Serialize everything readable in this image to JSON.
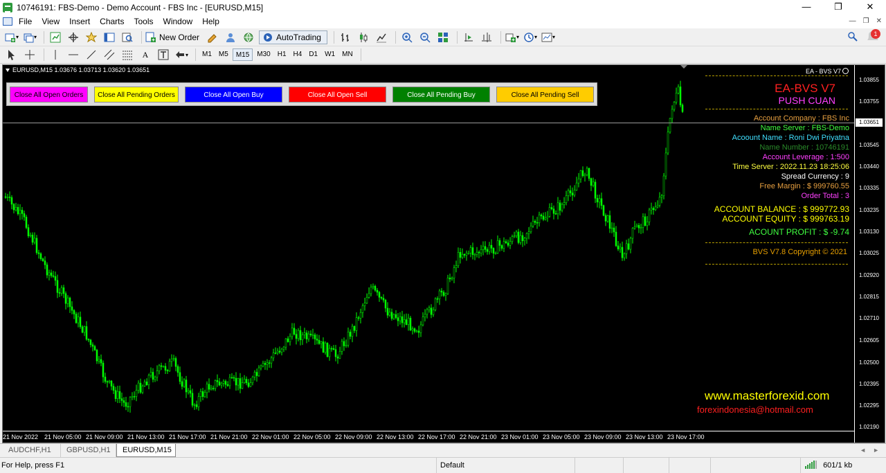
{
  "window": {
    "title": "10746191: FBS-Demo - Demo Account - FBS Inc - [EURUSD,M15]",
    "minimize": "—",
    "restore": "❐",
    "close": "✕"
  },
  "menu": [
    "File",
    "View",
    "Insert",
    "Charts",
    "Tools",
    "Window",
    "Help"
  ],
  "toolbar": {
    "new_order": "New Order",
    "autotrading": "AutoTrading"
  },
  "timeframes": [
    "M1",
    "M5",
    "M15",
    "M30",
    "H1",
    "H4",
    "D1",
    "W1",
    "MN"
  ],
  "active_timeframe": "M15",
  "chart": {
    "header": "EURUSD,M15  1.03676 1.03713 1.03620 1.03651",
    "ea_label": "EA - BVS V7",
    "current_price": "1.03651",
    "candle_color": "#00ff00"
  },
  "buttons": [
    {
      "label": "Close All Open Orders",
      "bg": "#ff00ff",
      "fg": "#000000"
    },
    {
      "label": "Close All Pending Orders",
      "bg": "#ffff00",
      "fg": "#000000"
    },
    {
      "label": "Close All Open Buy",
      "bg": "#0000ff",
      "fg": "#ffffff"
    },
    {
      "label": "Close All Open Sell",
      "bg": "#ff0000",
      "fg": "#ffffff"
    },
    {
      "label": "Close All Pending Buy",
      "bg": "#008000",
      "fg": "#ffffff"
    },
    {
      "label": "Close All Pending Sell",
      "bg": "#ffcc00",
      "fg": "#000000"
    }
  ],
  "info_panel": {
    "title": "EA-BVS V7",
    "subtitle": "PUSH CUAN",
    "account_company": "Account Company  : FBS Inc",
    "name_server": "Name Server  : FBS-Demo",
    "account_name": "Acoount Name  : Roni Dwi Priyatna",
    "name_number": "Name Number  : 10746191",
    "account_leverage": "Account Leverage  : 1:500",
    "time_server": "Time Server  : 2022.11.23 18:25:06",
    "spread_currency": "Spread Currency  : 9",
    "free_margin": "Free Margin  : $ 999760.55",
    "order_total": "Order Total  : 3",
    "account_balance": "ACCOUNT BALANCE  : $ 999772.93",
    "account_equity": "ACCOUNT EQUITY  : $ 999763.19",
    "account_profit": "ACOUNT PROFIT  : $ -9.74",
    "copyright": "BVS V7.8 Copyright © 2021"
  },
  "watermark": {
    "site": "www.masterforexid.com",
    "email": "forexindonesia@hotmail.com"
  },
  "price_axis": [
    "1.03855",
    "1.03755",
    "1.03545",
    "1.03440",
    "1.03335",
    "1.03235",
    "1.03130",
    "1.03025",
    "1.02920",
    "1.02815",
    "1.02710",
    "1.02605",
    "1.02500",
    "1.02395",
    "1.02295",
    "1.02190"
  ],
  "time_axis": [
    "21 Nov 2022",
    "21 Nov 05:00",
    "21 Nov 09:00",
    "21 Nov 13:00",
    "21 Nov 17:00",
    "21 Nov 21:00",
    "22 Nov 01:00",
    "22 Nov 05:00",
    "22 Nov 09:00",
    "22 Nov 13:00",
    "22 Nov 17:00",
    "22 Nov 21:00",
    "23 Nov 01:00",
    "23 Nov 05:00",
    "23 Nov 09:00",
    "23 Nov 13:00",
    "23 Nov 17:00"
  ],
  "tabs": [
    "AUDCHF,H1",
    "GBPUSD,H1",
    "EURUSD,M15"
  ],
  "active_tab": "EURUSD,M15",
  "status": {
    "help": "For Help, press F1",
    "profile": "Default",
    "traffic": "601/1 kb"
  },
  "notification_count": "1"
}
